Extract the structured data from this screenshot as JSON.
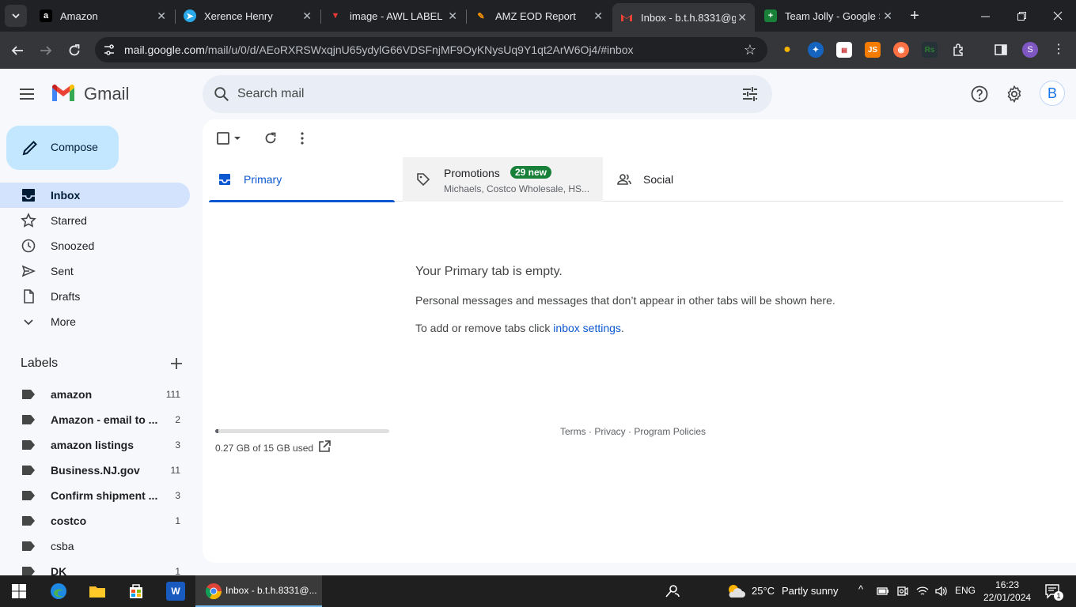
{
  "browser": {
    "tabs": [
      {
        "title": "Amazon",
        "favicon": "a",
        "fav_color": "#ffffff",
        "fav_bg": "#000000"
      },
      {
        "title": "Xerence Henry",
        "favicon": "telegram-icon",
        "fav_color": "#ffffff",
        "fav_bg": "#29a9ea"
      },
      {
        "title": "image - AWL LABEL",
        "favicon": "▼",
        "fav_color": "#e53935",
        "fav_bg": "transparent"
      },
      {
        "title": "AMZ EOD Report",
        "favicon": "✎",
        "fav_color": "#ff9800",
        "fav_bg": "transparent"
      },
      {
        "title": "Inbox - b.t.h.8331@g",
        "favicon": "M",
        "fav_color": "#ea4335",
        "fav_bg": "transparent"
      },
      {
        "title": "Team Jolly - Google S",
        "favicon": "+",
        "fav_color": "#ffffff",
        "fav_bg": "#188038"
      }
    ],
    "url_host": "mail.google.com",
    "url_path": "/mail/u/0/d/AEoRXRSWxqjnU65ydylG66VDSFnjMF9OyKNysUq9Y1qt2ArW6Oj4/#inbox",
    "profile_initial": "S"
  },
  "gmail": {
    "brand": "Gmail",
    "search_placeholder": "Search mail",
    "avatar_initial": "B",
    "compose_label": "Compose",
    "nav": [
      {
        "label": "Inbox",
        "icon": "inbox-icon",
        "active": true
      },
      {
        "label": "Starred",
        "icon": "star-icon"
      },
      {
        "label": "Snoozed",
        "icon": "clock-icon"
      },
      {
        "label": "Sent",
        "icon": "send-icon"
      },
      {
        "label": "Drafts",
        "icon": "draft-icon"
      },
      {
        "label": "More",
        "icon": "chevron-down-icon"
      }
    ],
    "labels_title": "Labels",
    "labels": [
      {
        "name": "amazon",
        "count": "111",
        "bold": true
      },
      {
        "name": "Amazon - email to ...",
        "count": "2",
        "bold": true
      },
      {
        "name": "amazon listings",
        "count": "3",
        "bold": true
      },
      {
        "name": "Business.NJ.gov",
        "count": "11",
        "bold": true
      },
      {
        "name": "Confirm shipment ...",
        "count": "3",
        "bold": true
      },
      {
        "name": "costco",
        "count": "1",
        "bold": true
      },
      {
        "name": "csba",
        "count": "",
        "bold": false
      },
      {
        "name": "DK",
        "count": "1",
        "bold": true
      }
    ],
    "tabs": {
      "primary": "Primary",
      "promotions": "Promotions",
      "promotions_badge": "29 new",
      "promotions_senders": "Michaels, Costco Wholesale, HS...",
      "social": "Social"
    },
    "empty": {
      "title": "Your Primary tab is empty.",
      "desc": "Personal messages and messages that don’t appear in other tabs will be shown here.",
      "hint_prefix": "To add or remove tabs click ",
      "hint_link": "inbox settings",
      "hint_suffix": "."
    },
    "storage": {
      "text": "0.27 GB of 15 GB used",
      "fraction": 0.018
    },
    "footer": {
      "terms": "Terms",
      "privacy": "Privacy",
      "policies": "Program Policies",
      "sep": " · "
    }
  },
  "taskbar": {
    "active_window": "Inbox - b.t.h.8331@...",
    "weather_temp": "25°C",
    "weather_desc": "Partly sunny",
    "lang": "ENG",
    "time": "16:23",
    "date": "22/01/2024",
    "notifications": "1"
  }
}
